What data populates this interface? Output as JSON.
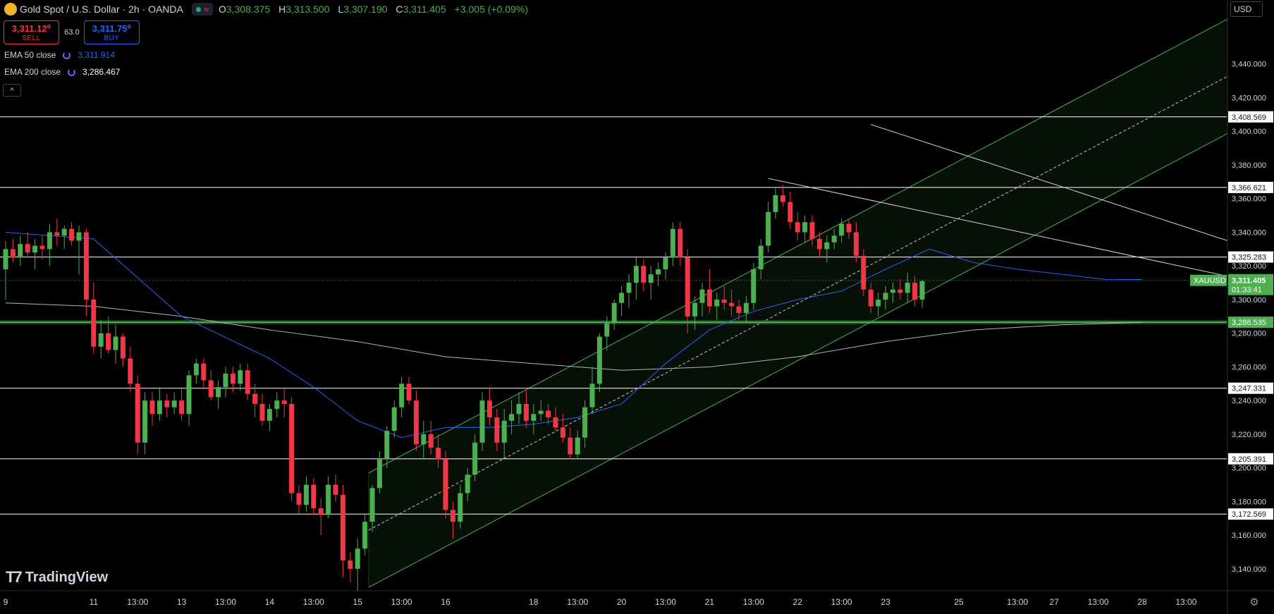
{
  "header": {
    "symbol_title": "Gold Spot / U.S. Dollar · 2h · OANDA",
    "ohlc": [
      {
        "k": "O",
        "v": "3,308.375"
      },
      {
        "k": "H",
        "v": "3,313.500"
      },
      {
        "k": "L",
        "v": "3,307.190"
      },
      {
        "k": "C",
        "v": "3,311.405"
      }
    ],
    "change": "+3.005 (+0.09%)",
    "status_wave": "≈"
  },
  "trade": {
    "sell_price": "3,311.12⁰",
    "sell_label": "SELL",
    "spread": "63.0",
    "buy_price": "3,311.75⁰",
    "buy_label": "BUY"
  },
  "indicators": [
    {
      "label": "EMA 50 close",
      "value": "3,311.914",
      "color": "#2962ff"
    },
    {
      "label": "EMA 200 close",
      "value": "3,286.467",
      "color": "#ffffff"
    }
  ],
  "toolbar": {
    "currency": "USD",
    "collapse": "^"
  },
  "watermark": "TradingView",
  "colors": {
    "up": "#4caf50",
    "down": "#f23645",
    "ema50": "#2962ff",
    "ema200": "#b2b5be",
    "channel": "#4caf50",
    "hline": "#ffffff",
    "support": "#4caf50"
  },
  "chart_data": {
    "type": "candlestick",
    "symbol": "XAUUSD",
    "timeframe": "2h",
    "y_range": [
      3127,
      3478
    ],
    "y_ticks": [
      3140,
      3160,
      3180,
      3200,
      3220,
      3240,
      3260,
      3280,
      3300,
      3320,
      3340,
      3360,
      3380,
      3400,
      3420,
      3440
    ],
    "y_tick_labels": [
      "3,140.000",
      "3,160.000",
      "3,180.000",
      "3,200.000",
      "3,220.000",
      "3,240.000",
      "3,260.000",
      "3,280.000",
      "3,300.000",
      "3,320.000",
      "3,340.000",
      "3,360.000",
      "3,380.000",
      "3,400.000",
      "3,420.000",
      "3,440.000"
    ],
    "x_ticks": [
      {
        "label": "9",
        "i": 0
      },
      {
        "label": "11",
        "i": 12
      },
      {
        "label": "13:00",
        "i": 18
      },
      {
        "label": "13",
        "i": 24
      },
      {
        "label": "13:00",
        "i": 30
      },
      {
        "label": "14",
        "i": 36
      },
      {
        "label": "13:00",
        "i": 42
      },
      {
        "label": "15",
        "i": 48
      },
      {
        "label": "13:00",
        "i": 54
      },
      {
        "label": "16",
        "i": 60
      },
      {
        "label": "18",
        "i": 72
      },
      {
        "label": "13:00",
        "i": 78
      },
      {
        "label": "20",
        "i": 84
      },
      {
        "label": "13:00",
        "i": 90
      },
      {
        "label": "21",
        "i": 96
      },
      {
        "label": "13:00",
        "i": 102
      },
      {
        "label": "22",
        "i": 108
      },
      {
        "label": "13:00",
        "i": 114
      },
      {
        "label": "23",
        "i": 120
      },
      {
        "label": "25",
        "i": 130
      },
      {
        "label": "13:00",
        "i": 138
      },
      {
        "label": "27",
        "i": 143
      },
      {
        "label": "13:00",
        "i": 149
      },
      {
        "label": "28",
        "i": 155
      },
      {
        "label": "13:00",
        "i": 161
      }
    ],
    "horizontal_levels": [
      {
        "value": 3408.569,
        "label": "3,408.569"
      },
      {
        "value": 3366.621,
        "label": "3,366.621"
      },
      {
        "value": 3325.283,
        "label": "3,325.283"
      },
      {
        "value": 3247.331,
        "label": "3,247.331"
      },
      {
        "value": 3205.391,
        "label": "3,205.391"
      },
      {
        "value": 3172.569,
        "label": "3,172.569"
      }
    ],
    "support_level": {
      "value": 3286.535,
      "label": "3,286.535"
    },
    "last_price": {
      "value": 3311.405,
      "label": "3,311.405",
      "countdown": "01:33:41",
      "symbol": "XAUUSD"
    },
    "candles": [
      [
        3318,
        3335,
        3300,
        3330
      ],
      [
        3330,
        3336,
        3322,
        3325
      ],
      [
        3325,
        3338,
        3320,
        3333
      ],
      [
        3333,
        3340,
        3325,
        3328
      ],
      [
        3328,
        3336,
        3318,
        3332
      ],
      [
        3332,
        3338,
        3324,
        3330
      ],
      [
        3330,
        3345,
        3320,
        3340
      ],
      [
        3340,
        3348,
        3332,
        3338
      ],
      [
        3338,
        3344,
        3330,
        3342
      ],
      [
        3342,
        3346,
        3332,
        3335
      ],
      [
        3335,
        3344,
        3315,
        3340
      ],
      [
        3340,
        3342,
        3290,
        3300
      ],
      [
        3300,
        3310,
        3268,
        3272
      ],
      [
        3272,
        3288,
        3265,
        3280
      ],
      [
        3280,
        3290,
        3268,
        3270
      ],
      [
        3270,
        3285,
        3262,
        3278
      ],
      [
        3278,
        3280,
        3260,
        3265
      ],
      [
        3265,
        3272,
        3245,
        3250
      ],
      [
        3250,
        3255,
        3208,
        3215
      ],
      [
        3215,
        3245,
        3208,
        3240
      ],
      [
        3240,
        3245,
        3225,
        3232
      ],
      [
        3232,
        3248,
        3228,
        3240
      ],
      [
        3240,
        3244,
        3230,
        3236
      ],
      [
        3236,
        3245,
        3232,
        3240
      ],
      [
        3240,
        3248,
        3228,
        3232
      ],
      [
        3232,
        3258,
        3225,
        3255
      ],
      [
        3255,
        3265,
        3250,
        3262
      ],
      [
        3262,
        3265,
        3248,
        3252
      ],
      [
        3252,
        3258,
        3240,
        3242
      ],
      [
        3242,
        3252,
        3235,
        3248
      ],
      [
        3248,
        3260,
        3242,
        3256
      ],
      [
        3256,
        3260,
        3245,
        3250
      ],
      [
        3250,
        3262,
        3246,
        3258
      ],
      [
        3258,
        3262,
        3240,
        3244
      ],
      [
        3244,
        3250,
        3230,
        3238
      ],
      [
        3238,
        3244,
        3225,
        3228
      ],
      [
        3228,
        3238,
        3222,
        3235
      ],
      [
        3235,
        3245,
        3230,
        3240
      ],
      [
        3240,
        3248,
        3230,
        3238
      ],
      [
        3238,
        3242,
        3180,
        3185
      ],
      [
        3185,
        3190,
        3172,
        3178
      ],
      [
        3178,
        3195,
        3174,
        3190
      ],
      [
        3190,
        3194,
        3172,
        3176
      ],
      [
        3176,
        3182,
        3160,
        3172
      ],
      [
        3172,
        3195,
        3170,
        3190
      ],
      [
        3190,
        3196,
        3180,
        3184
      ],
      [
        3184,
        3190,
        3135,
        3145
      ],
      [
        3145,
        3150,
        3132,
        3140
      ],
      [
        3140,
        3158,
        3127,
        3152
      ],
      [
        3152,
        3172,
        3148,
        3168
      ],
      [
        3168,
        3190,
        3162,
        3188
      ],
      [
        3188,
        3210,
        3185,
        3205
      ],
      [
        3205,
        3225,
        3200,
        3222
      ],
      [
        3222,
        3240,
        3218,
        3236
      ],
      [
        3236,
        3254,
        3230,
        3250
      ],
      [
        3250,
        3254,
        3238,
        3240
      ],
      [
        3240,
        3246,
        3210,
        3214
      ],
      [
        3214,
        3228,
        3205,
        3220
      ],
      [
        3220,
        3228,
        3208,
        3212
      ],
      [
        3212,
        3220,
        3200,
        3205
      ],
      [
        3205,
        3210,
        3170,
        3175
      ],
      [
        3175,
        3180,
        3158,
        3168
      ],
      [
        3168,
        3190,
        3164,
        3185
      ],
      [
        3185,
        3200,
        3180,
        3196
      ],
      [
        3196,
        3220,
        3192,
        3215
      ],
      [
        3215,
        3245,
        3210,
        3240
      ],
      [
        3240,
        3248,
        3225,
        3230
      ],
      [
        3230,
        3235,
        3210,
        3215
      ],
      [
        3215,
        3235,
        3205,
        3228
      ],
      [
        3228,
        3240,
        3220,
        3232
      ],
      [
        3232,
        3245,
        3226,
        3238
      ],
      [
        3238,
        3246,
        3224,
        3228
      ],
      [
        3228,
        3238,
        3220,
        3232
      ],
      [
        3232,
        3240,
        3228,
        3234
      ],
      [
        3234,
        3238,
        3226,
        3230
      ],
      [
        3230,
        3236,
        3222,
        3224
      ],
      [
        3224,
        3232,
        3215,
        3218
      ],
      [
        3218,
        3224,
        3205,
        3208
      ],
      [
        3208,
        3222,
        3205,
        3218
      ],
      [
        3218,
        3240,
        3212,
        3236
      ],
      [
        3236,
        3260,
        3232,
        3250
      ],
      [
        3250,
        3280,
        3245,
        3278
      ],
      [
        3278,
        3290,
        3270,
        3286
      ],
      [
        3286,
        3300,
        3282,
        3298
      ],
      [
        3298,
        3308,
        3290,
        3304
      ],
      [
        3304,
        3315,
        3295,
        3310
      ],
      [
        3310,
        3325,
        3300,
        3320
      ],
      [
        3320,
        3324,
        3305,
        3310
      ],
      [
        3310,
        3320,
        3300,
        3315
      ],
      [
        3315,
        3322,
        3308,
        3318
      ],
      [
        3318,
        3328,
        3312,
        3325
      ],
      [
        3325,
        3346,
        3320,
        3342
      ],
      [
        3342,
        3346,
        3320,
        3325
      ],
      [
        3325,
        3330,
        3280,
        3290
      ],
      [
        3290,
        3302,
        3282,
        3298
      ],
      [
        3298,
        3310,
        3290,
        3306
      ],
      [
        3306,
        3318,
        3292,
        3296
      ],
      [
        3296,
        3304,
        3288,
        3300
      ],
      [
        3300,
        3308,
        3294,
        3298
      ],
      [
        3298,
        3306,
        3290,
        3296
      ],
      [
        3296,
        3300,
        3288,
        3292
      ],
      [
        3292,
        3302,
        3286,
        3298
      ],
      [
        3298,
        3322,
        3294,
        3318
      ],
      [
        3318,
        3336,
        3312,
        3332
      ],
      [
        3332,
        3358,
        3328,
        3352
      ],
      [
        3352,
        3366,
        3348,
        3362
      ],
      [
        3362,
        3368,
        3355,
        3358
      ],
      [
        3358,
        3364,
        3342,
        3346
      ],
      [
        3346,
        3352,
        3335,
        3340
      ],
      [
        3340,
        3350,
        3334,
        3346
      ],
      [
        3346,
        3350,
        3332,
        3336
      ],
      [
        3336,
        3340,
        3325,
        3330
      ],
      [
        3330,
        3338,
        3322,
        3334
      ],
      [
        3334,
        3342,
        3330,
        3338
      ],
      [
        3338,
        3348,
        3334,
        3345
      ],
      [
        3345,
        3348,
        3336,
        3340
      ],
      [
        3340,
        3346,
        3322,
        3326
      ],
      [
        3326,
        3330,
        3302,
        3306
      ],
      [
        3306,
        3310,
        3292,
        3296
      ],
      [
        3296,
        3304,
        3290,
        3300
      ],
      [
        3300,
        3308,
        3294,
        3304
      ],
      [
        3304,
        3310,
        3298,
        3306
      ],
      [
        3306,
        3312,
        3300,
        3304
      ],
      [
        3304,
        3316,
        3298,
        3310
      ],
      [
        3310,
        3314,
        3296,
        3300
      ],
      [
        3300,
        3312,
        3295,
        3311
      ]
    ],
    "ema50": [
      [
        0,
        3340
      ],
      [
        12,
        3336
      ],
      [
        24,
        3290
      ],
      [
        36,
        3265
      ],
      [
        42,
        3248
      ],
      [
        48,
        3228
      ],
      [
        54,
        3218
      ],
      [
        60,
        3224
      ],
      [
        66,
        3224
      ],
      [
        72,
        3226
      ],
      [
        78,
        3230
      ],
      [
        84,
        3238
      ],
      [
        90,
        3262
      ],
      [
        96,
        3282
      ],
      [
        102,
        3293
      ],
      [
        108,
        3300
      ],
      [
        114,
        3305
      ],
      [
        120,
        3318
      ],
      [
        126,
        3330
      ],
      [
        132,
        3322
      ],
      [
        138,
        3318
      ],
      [
        144,
        3315
      ],
      [
        150,
        3312
      ],
      [
        155,
        3311.9
      ]
    ],
    "ema200": [
      [
        0,
        3298
      ],
      [
        12,
        3296
      ],
      [
        24,
        3290
      ],
      [
        36,
        3282
      ],
      [
        48,
        3275
      ],
      [
        60,
        3266
      ],
      [
        72,
        3262
      ],
      [
        84,
        3258
      ],
      [
        96,
        3260
      ],
      [
        108,
        3266
      ],
      [
        120,
        3275
      ],
      [
        132,
        3282
      ],
      [
        144,
        3285
      ],
      [
        155,
        3286.5
      ]
    ],
    "channel": {
      "mid_start": {
        "i": 49.5,
        "v": 3163
      },
      "mid_end": {
        "i": 172,
        "v": 3445
      },
      "half_width": 34
    },
    "trendlines": [
      {
        "from": {
          "i": 104,
          "v": 3372
        },
        "to": {
          "i": 173,
          "v": 3308
        }
      },
      {
        "from": {
          "i": 118,
          "v": 3404
        },
        "to": {
          "i": 173,
          "v": 3326
        }
      }
    ]
  }
}
